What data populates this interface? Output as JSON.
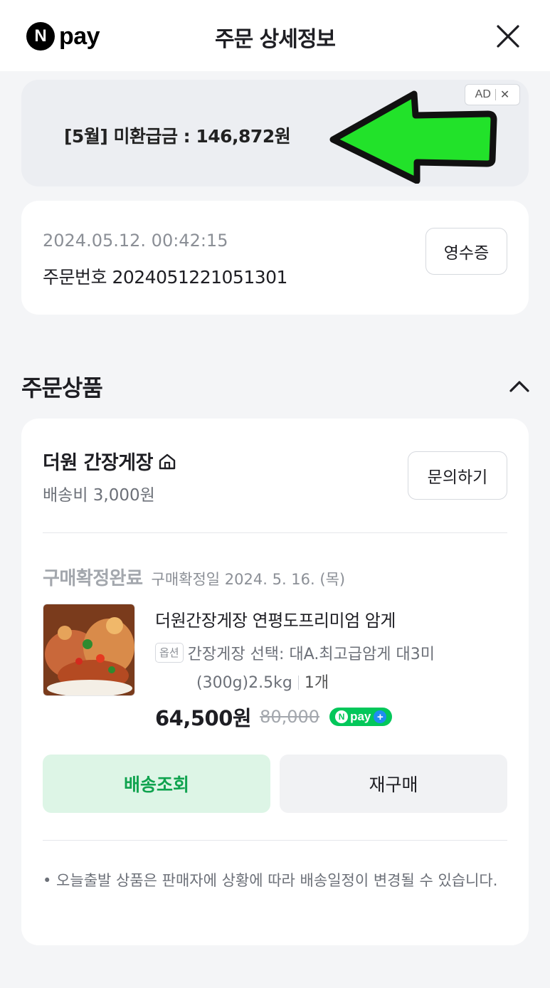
{
  "header": {
    "logo_n": "N",
    "logo_text": "pay",
    "title": "주문 상세정보",
    "close_icon": "close-icon"
  },
  "ad": {
    "text": "[5월] 미환급금 : 146,872원",
    "badge_label": "AD",
    "badge_close": "✕",
    "arrow_color": "#22e22a"
  },
  "order": {
    "datetime": "2024.05.12. 00:42:15",
    "number": "주문번호 2024051221051301",
    "receipt_label": "영수증"
  },
  "section": {
    "title": "주문상품"
  },
  "seller": {
    "name": "더원 간장게장",
    "shipping_fee": "배송비 3,000원",
    "inquiry_label": "문의하기"
  },
  "item": {
    "status": "구매확정완료",
    "confirm_date": "구매확정일 2024. 5. 16. (목)",
    "name": "더원간장게장 연평도프리미엄 암게",
    "option_tag": "옵션",
    "option_line1": "간장게장 선택: 대A.최고급암게 대3미",
    "option_line2": "(300g)2.5kg",
    "quantity": "1개",
    "price": "64,500원",
    "original_price": "80,000",
    "npay_badge": "pay"
  },
  "actions": {
    "track_label": "배송조회",
    "rebuy_label": "재구매"
  },
  "notice": "• 오늘출발 상품은 판매자에 상황에 따라 배송일정이 변경될 수 있습니다.",
  "colors": {
    "accent_green": "#03c75a",
    "track_bg": "#ddf5e6",
    "track_text": "#10a34f"
  }
}
